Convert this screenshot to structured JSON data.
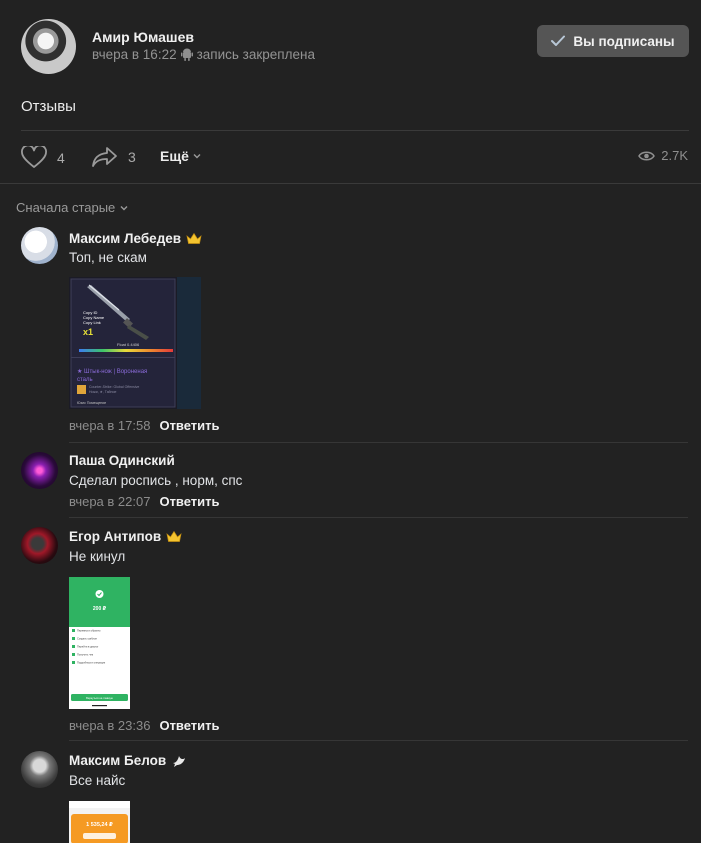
{
  "post": {
    "author": "Амир Юмашев",
    "time": "вчера в 16:22",
    "pinned": "запись закреплена",
    "subscribe_label": "Вы подписаны",
    "title": "Отзывы",
    "likes": "4",
    "shares": "3",
    "more_label": "Ещё",
    "views": "2.7K"
  },
  "sort_label": "Сначала старые",
  "reply_label": "Ответить",
  "comments": [
    {
      "name": "Максим Лебедев",
      "text": "Топ, не скам",
      "time": "вчера в 17:58",
      "badge": "crown-icon"
    },
    {
      "name": "Паша Одинский",
      "text": "Сделал роспись , норм, спс",
      "time": "вчера в 22:07",
      "badge": ""
    },
    {
      "name": "Егор Антипов",
      "text": "Не кинул",
      "time": "вчера в 23:36",
      "badge": "crown-icon"
    },
    {
      "name": "Максим Белов",
      "text": "Все найс",
      "time": "",
      "badge": "dove-icon"
    }
  ],
  "attachments": {
    "knife": {
      "menu_lines": [
        "Copy ID",
        "Copy Name",
        "Copy Link"
      ],
      "count": "x1",
      "float_label": "Float 0.4406",
      "item_name": "★ Штык-нож | Вороненая",
      "item_name_2": "сталь",
      "game": "Counter-Strike: Global Offensive",
      "market": "Ножи, ★, Тайное",
      "footer": "Юзис Помещение"
    },
    "receipt": {
      "amount": "200 ₽",
      "rows": [
        "Перевести обратно",
        "Создать шаблон",
        "Перейти в диалог",
        "Получить чек",
        "Подробности операции"
      ],
      "button": "Вернуться на главную"
    },
    "bank": {
      "amount": "1 535,24 ₽"
    }
  },
  "colors": {
    "background": "#222222",
    "button": "#555555",
    "accent_green": "#2fb362",
    "crown": "#f4c430"
  }
}
